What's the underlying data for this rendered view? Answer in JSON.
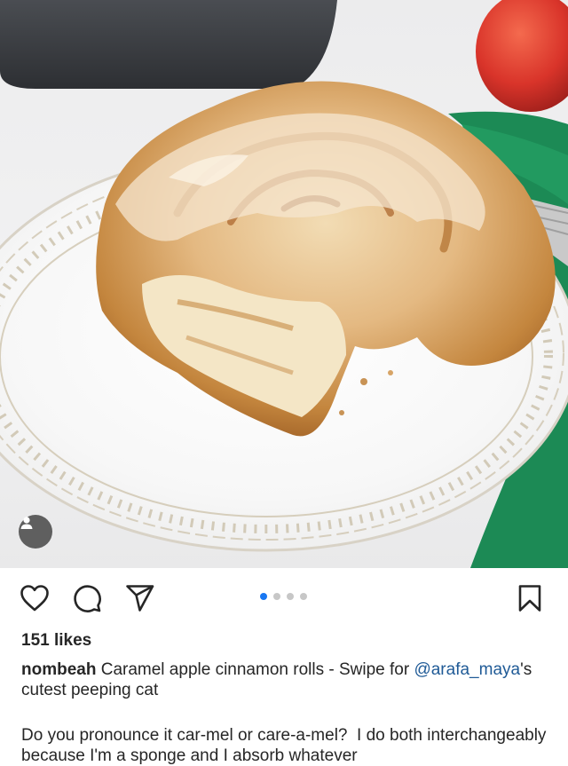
{
  "post": {
    "image_alt": "Caramel apple cinnamon roll on a white plate",
    "carousel": {
      "count": 4,
      "active_index": 0
    },
    "icons": {
      "like": "heart-icon",
      "comment": "comment-icon",
      "share": "send-icon",
      "save": "bookmark-icon",
      "tag": "user-tag-icon"
    },
    "likes": "151 likes",
    "caption": {
      "username": "nombeah",
      "text_before": " Caramel apple cinnamon rolls - Swipe for ",
      "mention": "@arafa_maya",
      "text_after": "'s cutest peeping cat"
    },
    "body": "Do you pronounce it car-mel or care-a-mel?  I do both interchangeably because I'm a sponge and I absorb whatever"
  },
  "colors": {
    "accent": "#1877f2",
    "mention": "#1f5a96",
    "text": "#262626",
    "tag_bg": "#5f5f5f"
  }
}
